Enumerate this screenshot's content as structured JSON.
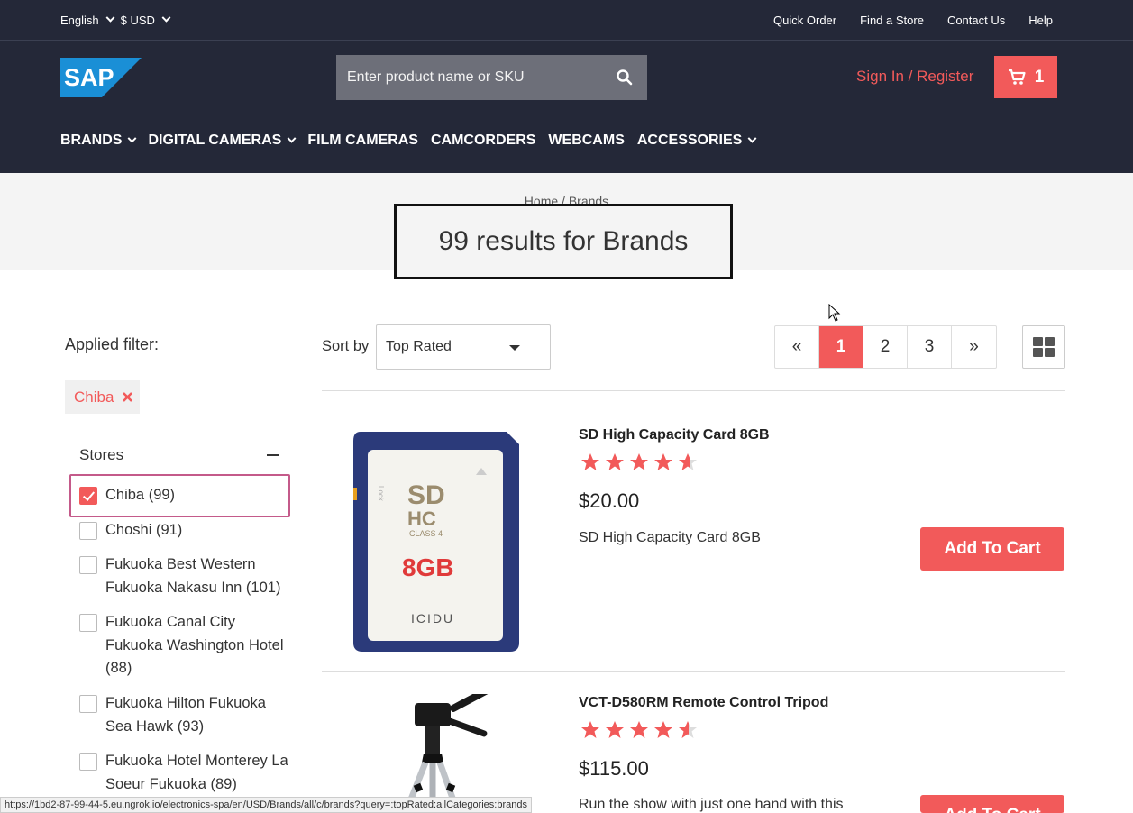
{
  "topbar": {
    "language": "English",
    "currency": "$ USD",
    "links": [
      "Quick Order",
      "Find a Store",
      "Contact Us",
      "Help"
    ]
  },
  "header": {
    "logo_text": "SAP",
    "search_placeholder": "Enter product name or SKU",
    "signin": "Sign In / Register",
    "cart_count": "1"
  },
  "nav": [
    {
      "label": "BRANDS",
      "dropdown": true
    },
    {
      "label": "DIGITAL CAMERAS",
      "dropdown": true
    },
    {
      "label": "FILM CAMERAS",
      "dropdown": false
    },
    {
      "label": "CAMCORDERS",
      "dropdown": false
    },
    {
      "label": "WEBCAMS",
      "dropdown": false
    },
    {
      "label": "ACCESSORIES",
      "dropdown": true
    }
  ],
  "breadcrumb": {
    "home": "Home",
    "sep": "/",
    "current": "Brands"
  },
  "page_title": "99 results for Brands",
  "filters": {
    "applied_label": "Applied filter:",
    "chip": "Chiba",
    "stores_heading": "Stores",
    "stores": [
      {
        "name": "Chiba (99)",
        "checked": true
      },
      {
        "name": "Choshi (91)",
        "checked": false
      },
      {
        "name": "Fukuoka Best Western Fukuoka Nakasu Inn (101)",
        "checked": false
      },
      {
        "name": "Fukuoka Canal City Fukuoka Washington Hotel (88)",
        "checked": false
      },
      {
        "name": "Fukuoka Hilton Fukuoka Sea Hawk (93)",
        "checked": false
      },
      {
        "name": "Fukuoka Hotel Monterey La Soeur Fukuoka (89)",
        "checked": false
      }
    ]
  },
  "sort": {
    "label": "Sort by",
    "value": "Top Rated"
  },
  "pagination": {
    "prev": "«",
    "pages": [
      "1",
      "2",
      "3"
    ],
    "active": "1",
    "next": "»"
  },
  "products": [
    {
      "name": "SD High Capacity Card 8GB",
      "rating": 4.5,
      "price": "$20.00",
      "description": "SD High Capacity Card 8GB",
      "button": "Add To Cart",
      "card_text": "8GB",
      "card_brand": "ICIDU"
    },
    {
      "name": "VCT-D580RM Remote Control Tripod",
      "rating": 4.5,
      "price": "$115.00",
      "description": "Run the show with just one hand with this",
      "button": "Add To Cart"
    }
  ],
  "status_url": "https://1bd2-87-99-44-5.eu.ngrok.io/electronics-spa/en/USD/Brands/all/c/brands?query=:topRated:allCategories:brands",
  "colors": {
    "accent": "#f25a5a",
    "header_bg": "#242838"
  }
}
